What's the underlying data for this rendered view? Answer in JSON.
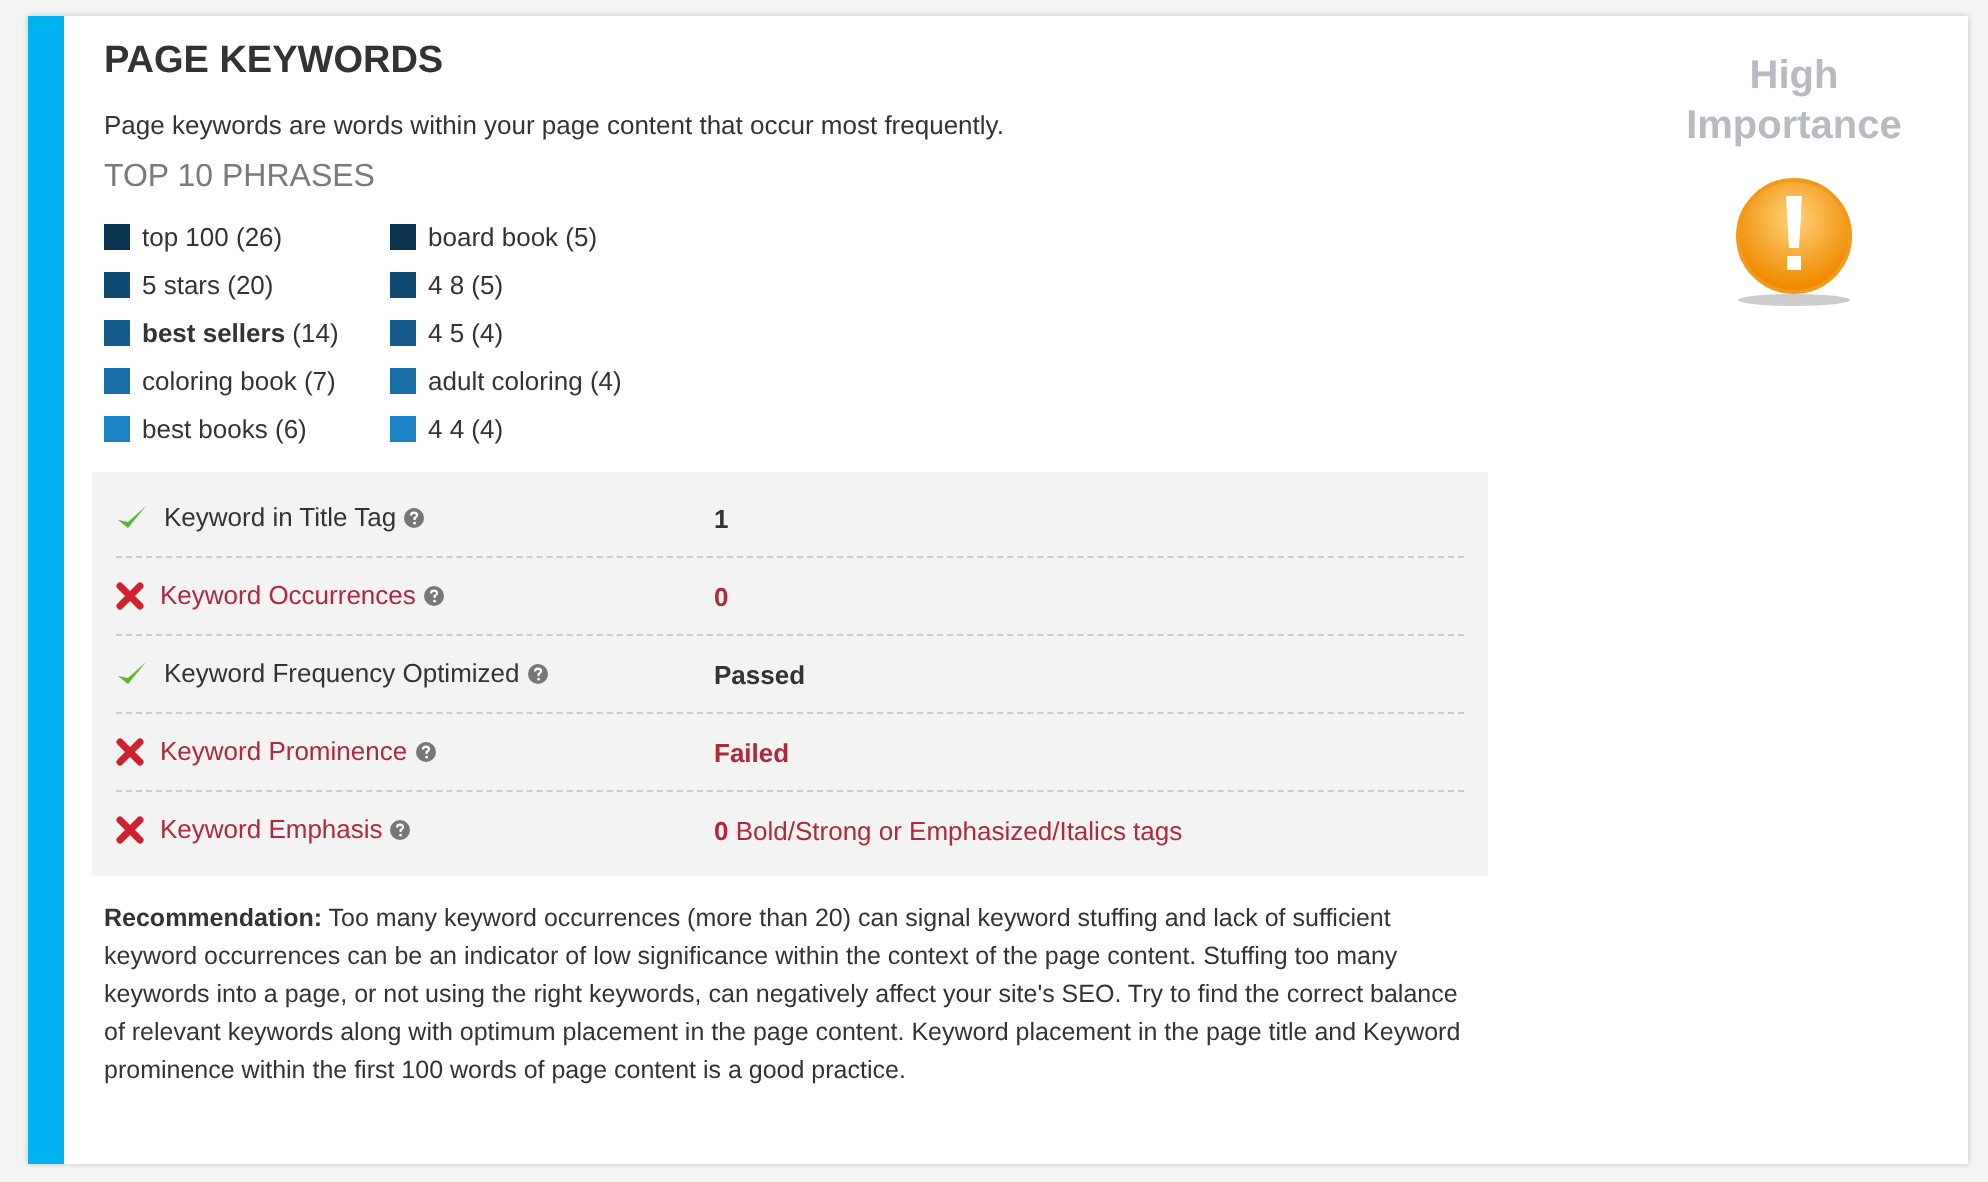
{
  "title": "PAGE KEYWORDS",
  "description": "Page keywords are words within your page content that occur most frequently.",
  "phrases_heading": "TOP 10 PHRASES",
  "phrases": [
    {
      "label": "top 100 (26)",
      "color": "#0b3452"
    },
    {
      "label": "5 stars (20)",
      "color": "#0f4a73"
    },
    {
      "label": "**best sellers** (14)",
      "color": "#135b8c"
    },
    {
      "label": "coloring book (7)",
      "color": "#186fa8"
    },
    {
      "label": "best books (6)",
      "color": "#1c84c6"
    },
    {
      "label": "board book (5)",
      "color": "#0b3452"
    },
    {
      "label": "4 8 (5)",
      "color": "#0f4a73"
    },
    {
      "label": "4 5 (4)",
      "color": "#135b8c"
    },
    {
      "label": "adult coloring (4)",
      "color": "#186fa8"
    },
    {
      "label": "4 4 (4)",
      "color": "#1c84c6"
    }
  ],
  "checks": [
    {
      "label": "Keyword in Title Tag",
      "passed": true,
      "value": "1"
    },
    {
      "label": "Keyword Occurrences",
      "passed": false,
      "value": "0"
    },
    {
      "label": "Keyword Frequency Optimized",
      "passed": true,
      "value": "Passed"
    },
    {
      "label": "Keyword Prominence",
      "passed": false,
      "value": "Failed"
    },
    {
      "label": "Keyword Emphasis",
      "passed": false,
      "value": "**0** Bold/Strong or Emphasized/Italics tags"
    }
  ],
  "recommendation": "**Recommendation:** Too many keyword occurrences (more than 20) can signal keyword stuffing and lack of sufficient keyword occurrences can be an indicator of low significance within the context of the page content. Stuffing too many keywords into a page, or not using the right keywords, can negatively affect your site's SEO. Try to find the correct balance of relevant keywords along with optimum placement in the page content. Keyword placement in the page title and Keyword prominence within the first 100 words of page content is a good practice.",
  "importance": {
    "label": "High Importance",
    "high": true
  }
}
